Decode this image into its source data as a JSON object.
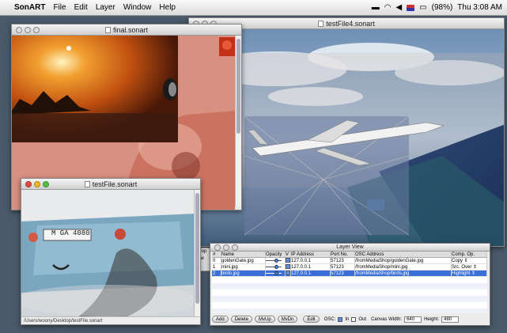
{
  "menubar": {
    "app": "SonART",
    "items": [
      "File",
      "Edit",
      "Layer",
      "Window",
      "Help"
    ],
    "battery": "(98%)",
    "clock": "Thu 3:08 AM"
  },
  "windows": {
    "testfile4": {
      "title": "testFile4.sonart"
    },
    "final": {
      "title": "final.sonart"
    },
    "testfile": {
      "title": "testFile.sonart",
      "status_path": "/Users/woony/Desktop/testFile.sonart"
    }
  },
  "background_window": {
    "stub_label": "stop",
    "stub_label2": "ew"
  },
  "layer_view": {
    "title": "Layer View",
    "columns": [
      "#",
      "Name",
      "Opacity",
      "V",
      "IP Address",
      "Port No.",
      "OSC Address",
      "Comp. Op."
    ],
    "rows": [
      {
        "num": "0",
        "name": "goldenGate.jpg",
        "opacity": 0.75,
        "visible": true,
        "ip": "127.0.0.1",
        "port": "57123",
        "osc": "/fromMediaShop/goldenGate.jpg",
        "comp": "Copy",
        "selected": false
      },
      {
        "num": "1",
        "name": "mini.jpg",
        "opacity": 0.75,
        "visible": true,
        "ip": "127.0.0.1",
        "port": "57123",
        "osc": "/fromMediaShop/mini.jpg",
        "comp": "Src. Over",
        "selected": false
      },
      {
        "num": "2",
        "name": "birds.jpg",
        "opacity": 0.75,
        "visible": true,
        "ip": "127.0.0.1",
        "port": "57123",
        "osc": "/fromMediaShop/birds.jpg",
        "comp": "Highlight",
        "selected": true
      }
    ],
    "buttons": {
      "add": "Add",
      "delete": "Delete",
      "mvup": "MvUp",
      "mvdn": "MvDn",
      "edit": "Edit"
    },
    "osc_label": "OSC:",
    "osc_in": "In",
    "osc_out": "Out",
    "canvas_width_label": "Canvas Width:",
    "canvas_width": "640",
    "height_label": "Height:",
    "height": "480"
  }
}
